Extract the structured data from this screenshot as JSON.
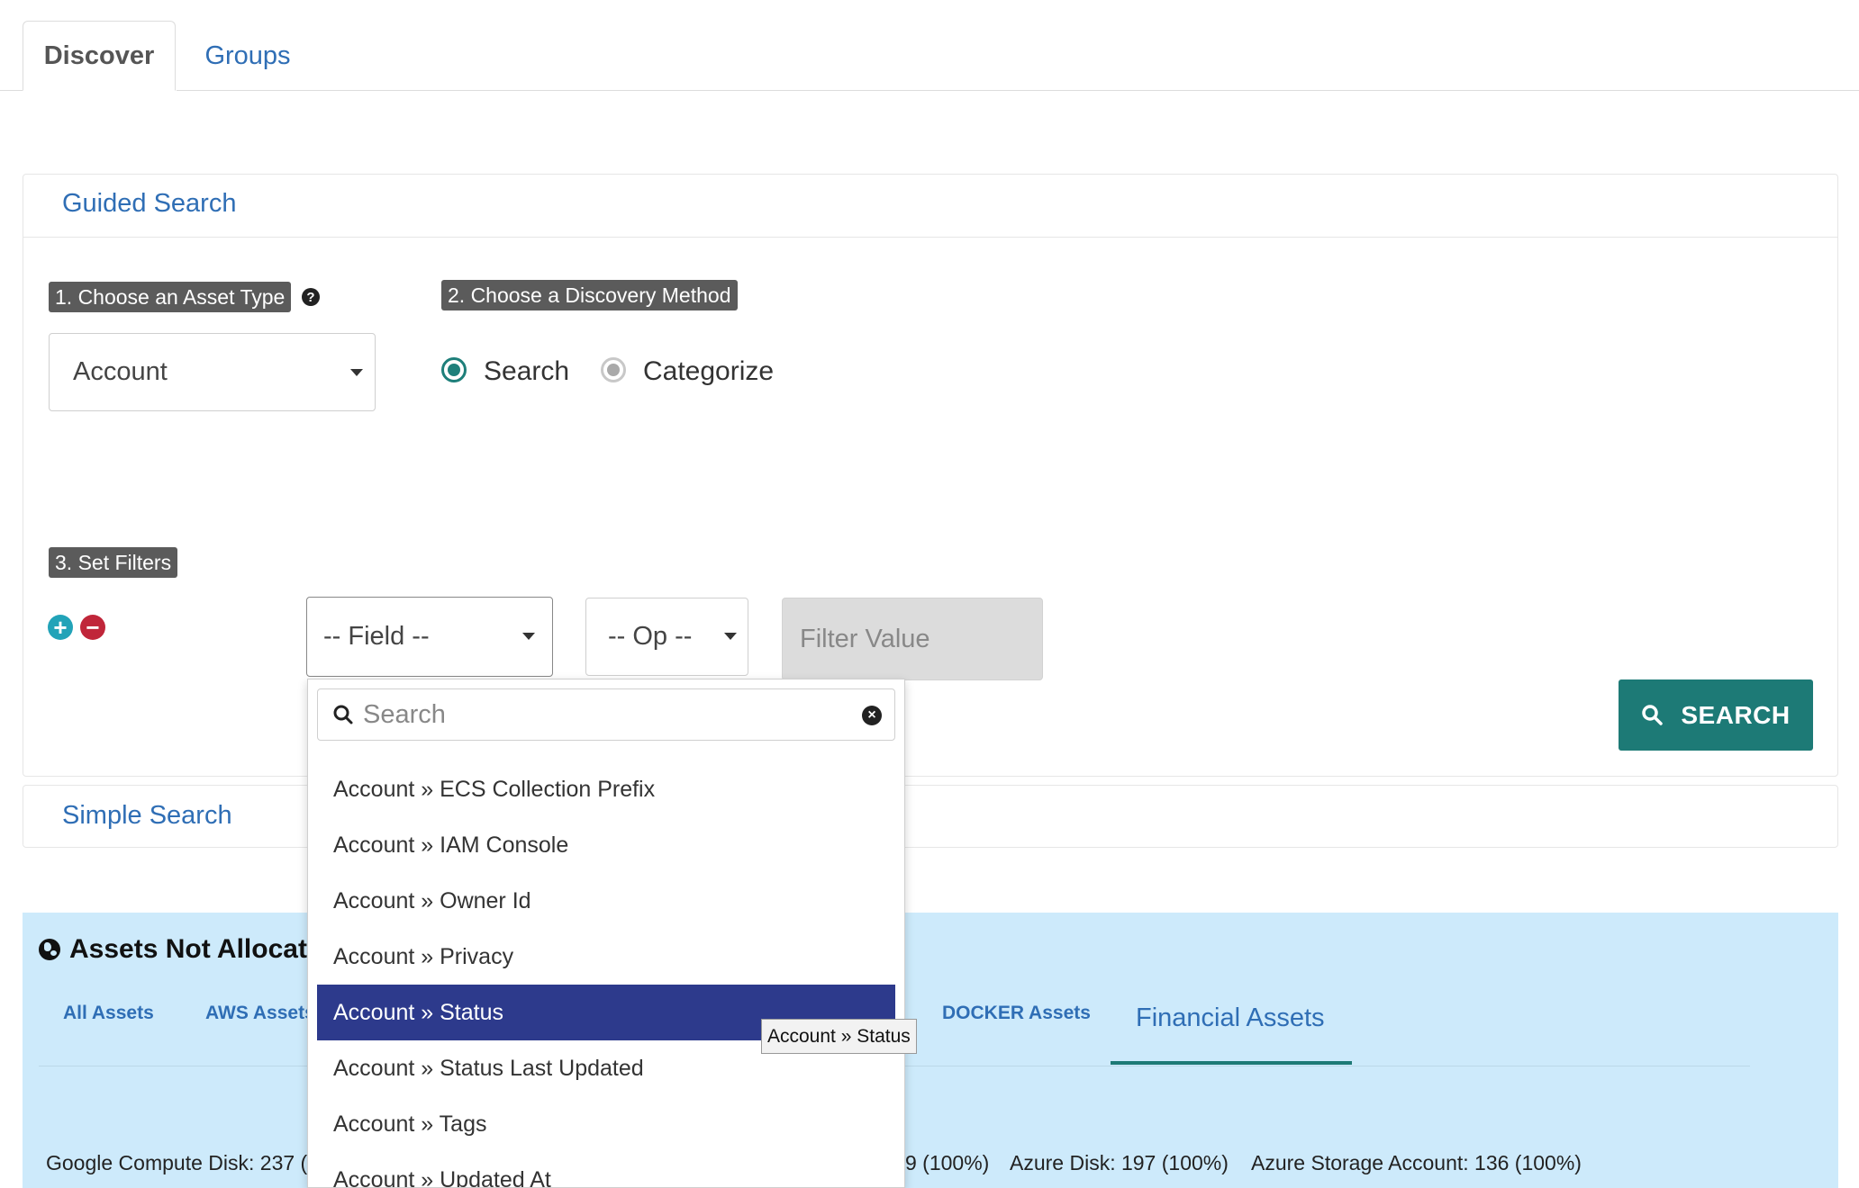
{
  "tabs": [
    {
      "label": "Discover",
      "active": true
    },
    {
      "label": "Groups",
      "active": false
    }
  ],
  "guided_search": {
    "title": "Guided Search",
    "step1": {
      "label": "1. Choose an Asset Type",
      "help_icon": "question-circle-icon",
      "selected": "Account"
    },
    "step2": {
      "label": "2. Choose a Discovery Method",
      "options": [
        {
          "label": "Search",
          "checked": true
        },
        {
          "label": "Categorize",
          "checked": false
        }
      ]
    },
    "step3": {
      "label": "3. Set Filters",
      "field_select": "-- Field --",
      "op_select": "-- Op --",
      "value_placeholder": "Filter Value"
    },
    "search_button": "SEARCH"
  },
  "simple_search": {
    "title": "Simple Search"
  },
  "assets": {
    "title": "Assets Not Allocated",
    "tabs": [
      "All Assets",
      "AWS Assets",
      "DOCKER Assets",
      "Financial Assets"
    ],
    "active_tab": "Financial Assets",
    "stats_line1": [
      "Google Compute Disk: 237 (",
      "9 (100%)",
      "Azure Disk: 197 (100%)",
      "Azure Storage Account: 136 (100%)"
    ]
  },
  "field_dropdown": {
    "search_placeholder": "Search",
    "items": [
      "Account » ECS Collection Prefix",
      "Account » IAM Console",
      "Account » Owner Id",
      "Account » Privacy",
      "Account » Status",
      "Account » Status Last Updated",
      "Account » Tags",
      "Account » Updated At"
    ],
    "selected_index": 4,
    "tooltip": "Account » Status"
  },
  "colors": {
    "link": "#2f6eb5",
    "primary": "#1d7a76",
    "selected_item": "#2d3a8c",
    "assets_bg": "#cdeafb"
  }
}
